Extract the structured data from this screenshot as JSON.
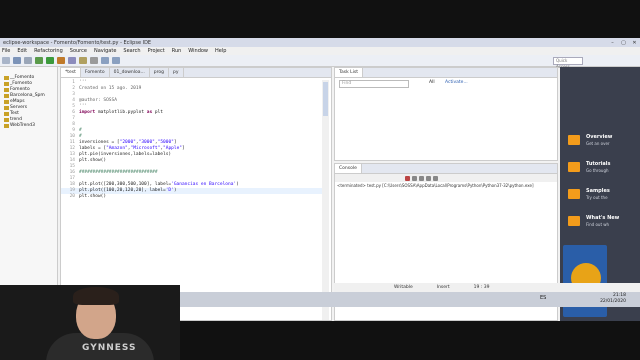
{
  "window": {
    "title": "eclipse-workspace - Fomento/Fomento/test.py - Eclipse IDE",
    "controls": [
      "–",
      "▢",
      "✕"
    ]
  },
  "menu": [
    "File",
    "Edit",
    "Refactoring",
    "Source",
    "Navigate",
    "Search",
    "Project",
    "Run",
    "Window",
    "Help"
  ],
  "toolbar": {
    "quick_access": "Quick Access"
  },
  "package_explorer": {
    "items": [
      "__Fomento",
      "_Fomento",
      "Fomento",
      "Barcelona_Spm",
      "eMaps",
      "Servers",
      "Test",
      "trend",
      "WebTrend3"
    ]
  },
  "editor": {
    "tabs": [
      "*test",
      "Fomento",
      "01_downloa...",
      "prog",
      "py"
    ],
    "lines": [
      {
        "n": "1",
        "html": "<span class='dc'>'''</span>"
      },
      {
        "n": "2",
        "html": "<span class='dc'>Created on 15 ago. 2019</span>"
      },
      {
        "n": "3",
        "html": ""
      },
      {
        "n": "4",
        "html": "<span class='dc'>@author: SOSSA</span>"
      },
      {
        "n": "5",
        "html": "<span class='dc'>'''</span>"
      },
      {
        "n": "6",
        "html": "<span class='kw'>import</span> matplotlib.pyplot <span class='kw'>as</span> plt"
      },
      {
        "n": "7",
        "html": ""
      },
      {
        "n": "8",
        "html": ""
      },
      {
        "n": "9",
        "html": "<span class='cm'>#</span>"
      },
      {
        "n": "10",
        "html": "<span class='cm'>#</span>"
      },
      {
        "n": "11",
        "html": "inversiones = [<span class='st'>\"2000\"</span>,<span class='st'>\"3000\"</span>,<span class='st'>\"5000\"</span>]"
      },
      {
        "n": "12",
        "html": "labels = [<span class='st'>\"Amazon\"</span>,<span class='st'>\"Microsoft\"</span>,<span class='st'>\"Apple\"</span>]"
      },
      {
        "n": "13",
        "html": "plt.pie(inversiones,labels=labels)"
      },
      {
        "n": "14",
        "html": "plt.show()"
      },
      {
        "n": "15",
        "html": ""
      },
      {
        "n": "16",
        "html": "<span class='cm'>#############################</span>"
      },
      {
        "n": "17",
        "html": ""
      },
      {
        "n": "18",
        "html": "plt.plot([200,300,500,100], label=<span class='st'>'Ganancias en Barcelona'</span>)"
      },
      {
        "n": "19",
        "html": "plt.plot([100,20,120,20], label=<span class='st'>'D'</span>)",
        "highlight": true
      },
      {
        "n": "20",
        "html": "plt.show()"
      }
    ]
  },
  "task_list": {
    "title": "Task List",
    "search_placeholder": "Find",
    "all": "All",
    "activate": "Activate..."
  },
  "console": {
    "title": "Console",
    "line": "<terminated> test.py [C:\\Users\\SOSSA\\AppData\\Local\\Programs\\Python\\Python37-32\\python.exe]"
  },
  "welcome": [
    {
      "title": "Overview",
      "sub": "Get an over"
    },
    {
      "title": "Tutorials",
      "sub": "Go through"
    },
    {
      "title": "Samples",
      "sub": "Try out the"
    },
    {
      "title": "What's New",
      "sub": "Find out wh"
    }
  ],
  "status": {
    "writable": "Writable",
    "insert": "Insert",
    "position": "19 : 39"
  },
  "taskbar": {
    "lang": "ES",
    "time": "21:18",
    "date": "22/01/2020"
  },
  "webcam": {
    "shirt_text": "GYNNESS"
  }
}
